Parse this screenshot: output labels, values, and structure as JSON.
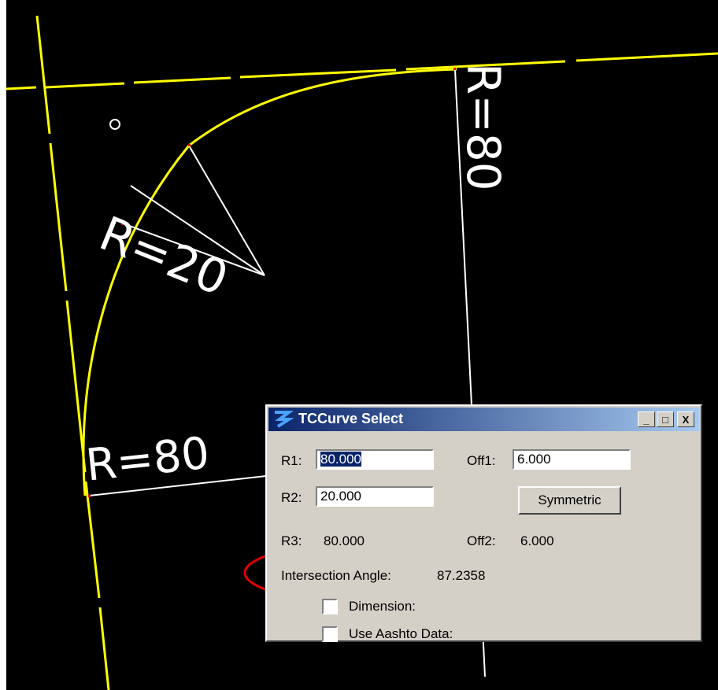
{
  "cad": {
    "label_r20": "R=20",
    "label_r80_right": "R=80",
    "label_r80_left": "R=80",
    "colors": {
      "background": "#000000",
      "alignment": "#ffff00",
      "dimension": "#ffffff",
      "highlight": "#ff0000"
    }
  },
  "dialog": {
    "title": "TCCurve Select",
    "window_buttons": {
      "minimize": "_",
      "maximize": "□",
      "close": "X"
    },
    "r1_label": "R1:",
    "r1_value": "80.000",
    "off1_label": "Off1:",
    "off1_value": "6.000",
    "r2_label": "R2:",
    "r2_value": "20.000",
    "symmetric_button": "Symmetric",
    "r3_label": "R3:",
    "r3_value": "80.000",
    "off2_label": "Off2:",
    "off2_value": "6.000",
    "angle_label": "Intersection Angle:",
    "angle_value": "87.2358",
    "dimension_label": "Dimension:",
    "dimension_checked": false,
    "aashto_label": "Use Aashto Data:",
    "aashto_checked": false
  }
}
